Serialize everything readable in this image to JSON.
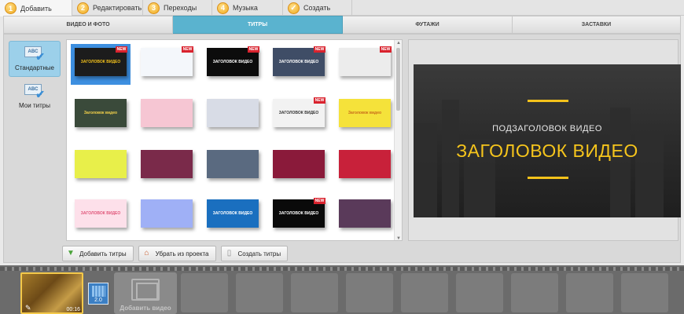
{
  "steps": [
    {
      "num": "1",
      "label": "Добавить"
    },
    {
      "num": "2",
      "label": "Редактировать"
    },
    {
      "num": "3",
      "label": "Переходы"
    },
    {
      "num": "4",
      "label": "Музыка"
    },
    {
      "num": "✓",
      "label": "Создать"
    }
  ],
  "category_tabs": [
    {
      "label": "ВИДЕО И ФОТО"
    },
    {
      "label": "ТИТРЫ"
    },
    {
      "label": "ФУТАЖИ"
    },
    {
      "label": "ЗАСТАВКИ"
    }
  ],
  "sidebar": {
    "items": [
      {
        "label": "Стандартные",
        "icon_text": "ABC"
      },
      {
        "label": "Мои титры",
        "icon_text": "ABC"
      }
    ]
  },
  "grid": {
    "new_label": "NEW",
    "items": [
      {
        "text": "ЗАГОЛОВОК ВИДЕО",
        "bg": "#1c1c1c",
        "fg": "#f4c21b",
        "new": true
      },
      {
        "text": "",
        "bg": "#f4f7fb",
        "fg": "#4f7fc1",
        "new": true
      },
      {
        "text": "ЗАГОЛОВОК ВИДЕО",
        "bg": "#0c0c0c",
        "fg": "#ffffff",
        "new": true
      },
      {
        "text": "ЗАГОЛОВОК ВИДЕО",
        "bg": "#3f4d66",
        "fg": "#ffffff",
        "new": true
      },
      {
        "text": "",
        "bg": "#ececec",
        "fg": "#8a8a8a",
        "new": true
      },
      {
        "text": "Заголовок видео",
        "bg": "#3a4a3a",
        "fg": "#f6d34a",
        "new": false
      },
      {
        "text": "",
        "bg": "#f6c6d3",
        "fg": "#b05a7a",
        "new": false
      },
      {
        "text": "",
        "bg": "#d8dce6",
        "fg": "#e03030",
        "new": false
      },
      {
        "text": "ЗАГОЛОВОК ВИДЕО",
        "bg": "#f2f2f2",
        "fg": "#333333",
        "new": true
      },
      {
        "text": "Заголовок видео",
        "bg": "#f5e23a",
        "fg": "#c86a1a",
        "new": false
      },
      {
        "text": "",
        "bg": "#e8ef4a",
        "fg": "#4a7a2a",
        "new": false
      },
      {
        "text": "",
        "bg": "#7a2a4a",
        "fg": "#ffffff",
        "new": false
      },
      {
        "text": "",
        "bg": "#5a6a80",
        "fg": "#ffffff",
        "new": false
      },
      {
        "text": "",
        "bg": "#8a1a3a",
        "fg": "#ffffff",
        "new": false
      },
      {
        "text": "",
        "bg": "#c8213a",
        "fg": "#ffffff",
        "new": false
      },
      {
        "text": "ЗАГОЛОВОК ВИДЕО",
        "bg": "#fde0ea",
        "fg": "#e0567a",
        "new": false
      },
      {
        "text": "",
        "bg": "#9fb0f6",
        "fg": "#ffffff",
        "new": false
      },
      {
        "text": "ЗАГОЛОВОК ВИДЕО",
        "bg": "#1a6fbf",
        "fg": "#ffffff",
        "new": false
      },
      {
        "text": "ЗАГОЛОВОК ВИДЕО",
        "bg": "#0a0a0a",
        "fg": "#ffffff",
        "new": true
      },
      {
        "text": "",
        "bg": "#5a3a5a",
        "fg": "#ffffff",
        "new": false
      }
    ]
  },
  "preview": {
    "subtitle": "ПОДЗАГОЛОВОК ВИДЕО",
    "title": "ЗАГОЛОВОК ВИДЕО"
  },
  "actions": {
    "add": "Добавить титры",
    "remove": "Убрать из проекта",
    "create": "Создать титры"
  },
  "timeline": {
    "clip_duration": "00:16",
    "transition_duration": "2.0",
    "add_video_label": "Добавить видео"
  },
  "colors": {
    "accent": "#5ab3cf",
    "title_yellow": "#f4c21b",
    "selection": "#3d8fe0",
    "new_badge": "#d9232e"
  }
}
